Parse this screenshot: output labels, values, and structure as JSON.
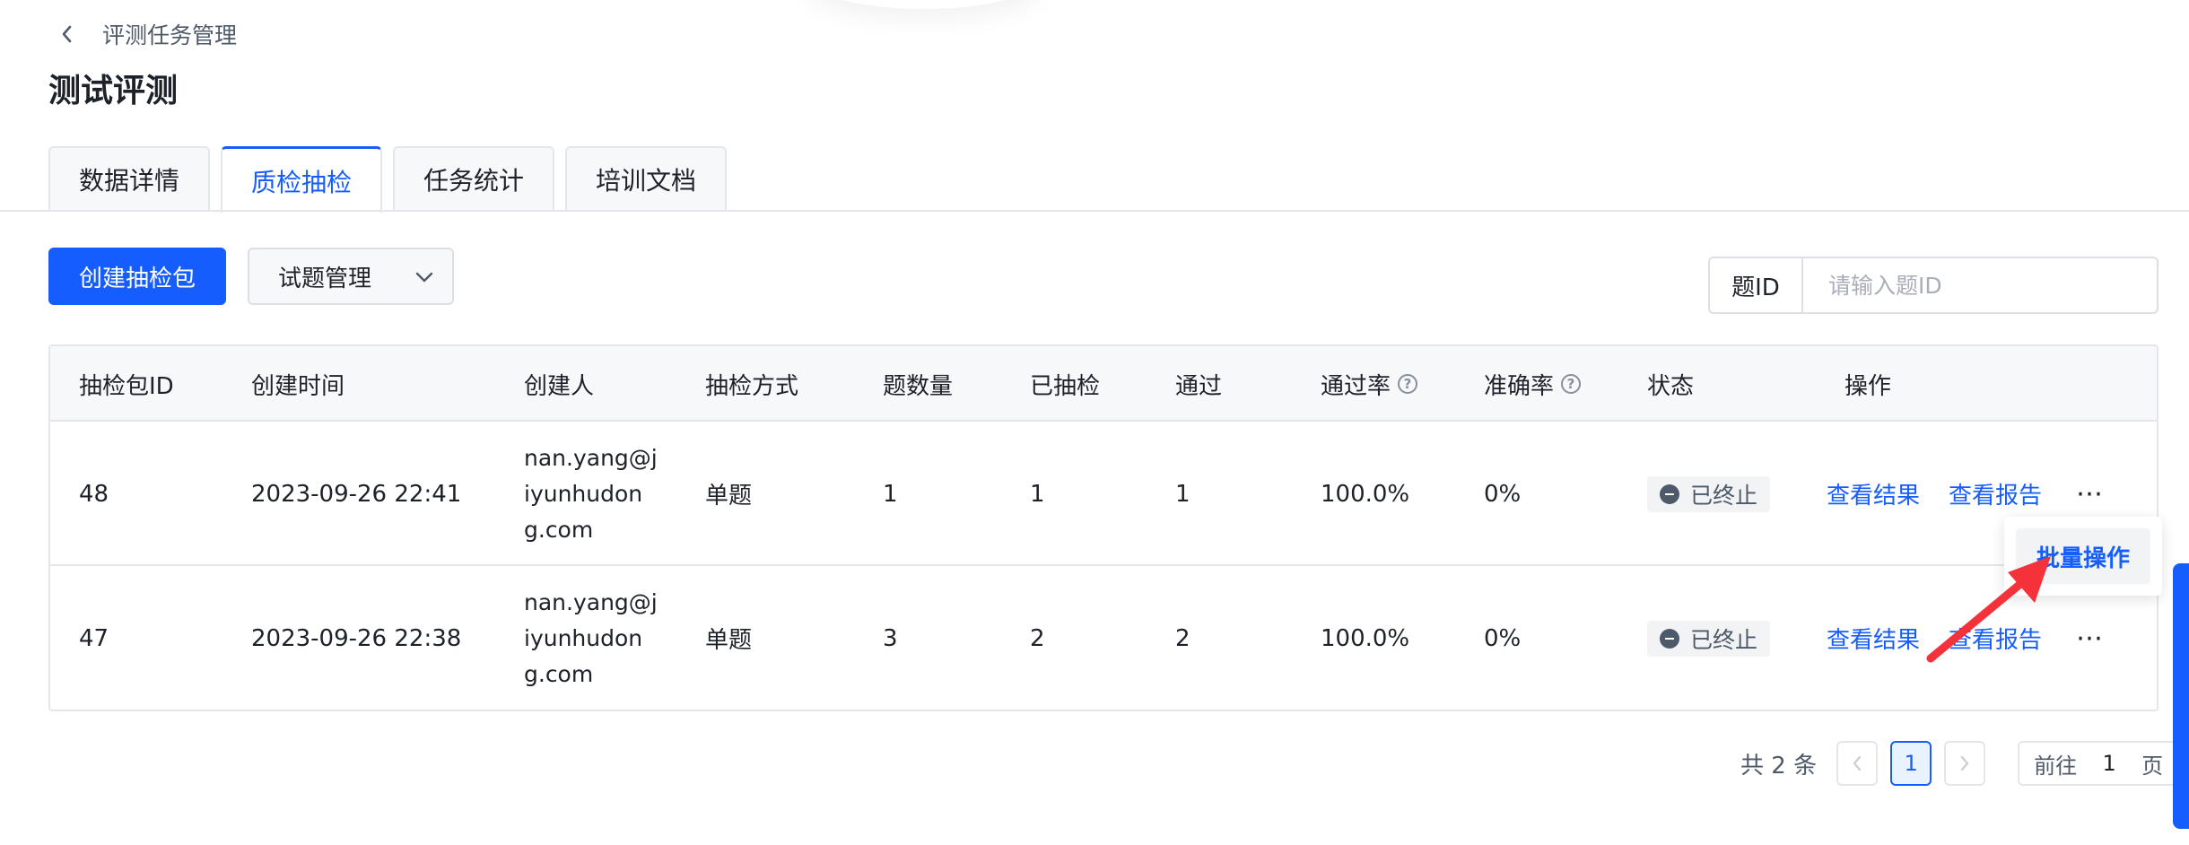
{
  "breadcrumb": {
    "back_icon": "chevron-left-icon",
    "text": "评测任务管理"
  },
  "page_title": "测试评测",
  "tabs": [
    {
      "label": "数据详情",
      "active": false
    },
    {
      "label": "质检抽检",
      "active": true
    },
    {
      "label": "任务统计",
      "active": false
    },
    {
      "label": "培训文档",
      "active": false
    }
  ],
  "toolbar": {
    "create_label": "创建抽检包",
    "manage_label": "试题管理",
    "manage_icon": "chevron-down-icon"
  },
  "search": {
    "label": "题ID",
    "placeholder": "请输入题ID",
    "value": ""
  },
  "table": {
    "headers": [
      "抽检包ID",
      "创建时间",
      "创建人",
      "抽检方式",
      "题数量",
      "已抽检",
      "通过",
      "通过率",
      "准确率",
      "状态",
      "操作"
    ],
    "rows": [
      {
        "id": "48",
        "created": "2023-09-26 22:41",
        "creator": "nan.yang@jiyunhudong.com",
        "method": "单题",
        "count": "1",
        "checked": "1",
        "passed": "1",
        "pass_rate": "100.0%",
        "accuracy": "0%",
        "status": "已终止",
        "action_result": "查看结果",
        "action_report": "查看报告"
      },
      {
        "id": "47",
        "created": "2023-09-26 22:38",
        "creator": "nan.yang@jiyunhudong.com",
        "method": "单题",
        "count": "3",
        "checked": "2",
        "passed": "2",
        "pass_rate": "100.0%",
        "accuracy": "0%",
        "status": "已终止",
        "action_result": "查看结果",
        "action_report": "查看报告"
      }
    ]
  },
  "popup": {
    "item_label": "批量操作"
  },
  "pagination": {
    "total": "共 2 条",
    "current_page": "1",
    "jump_prefix": "前往",
    "jump_value": "1",
    "jump_suffix": "页"
  },
  "colors": {
    "primary": "#165dff",
    "annotation_arrow": "#f5323a"
  }
}
